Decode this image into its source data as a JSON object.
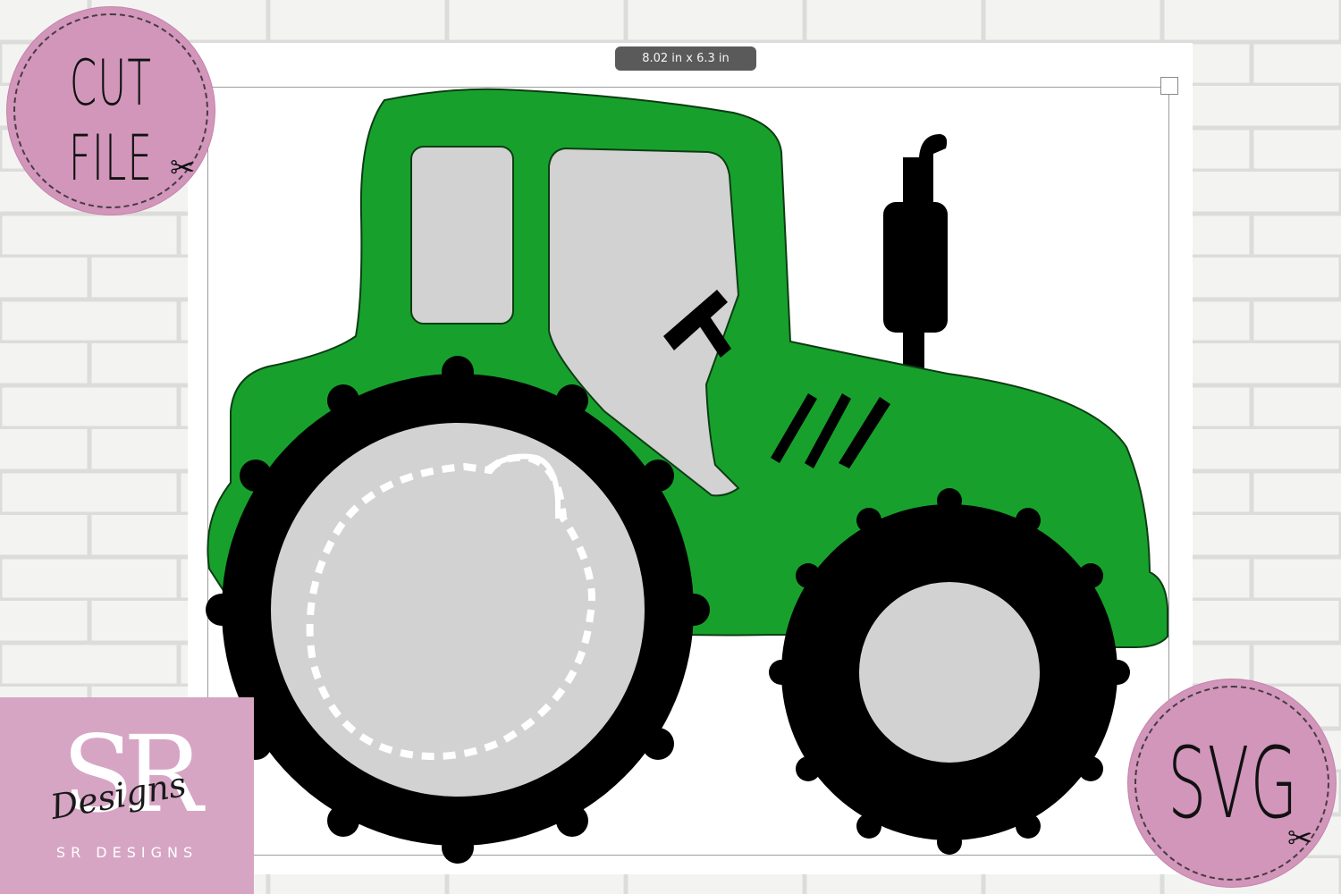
{
  "canvas": {
    "size_readout": "8.02 in x 6.3 in"
  },
  "badges": {
    "cut_file": {
      "line1": "CUT",
      "line2": "FILE",
      "icon": "scissors-icon"
    },
    "svg": {
      "label": "SVG",
      "icon": "scissors-icon"
    }
  },
  "logo": {
    "monogram": "SR",
    "script": "Designs",
    "name": "SR DESIGNS"
  },
  "colors": {
    "tractor_body": "#17a12c",
    "tractor_glass": "#d2d2d2",
    "tires": "#000000",
    "badge_pink": "#d196ba",
    "logo_pink": "#d7a5c4"
  }
}
